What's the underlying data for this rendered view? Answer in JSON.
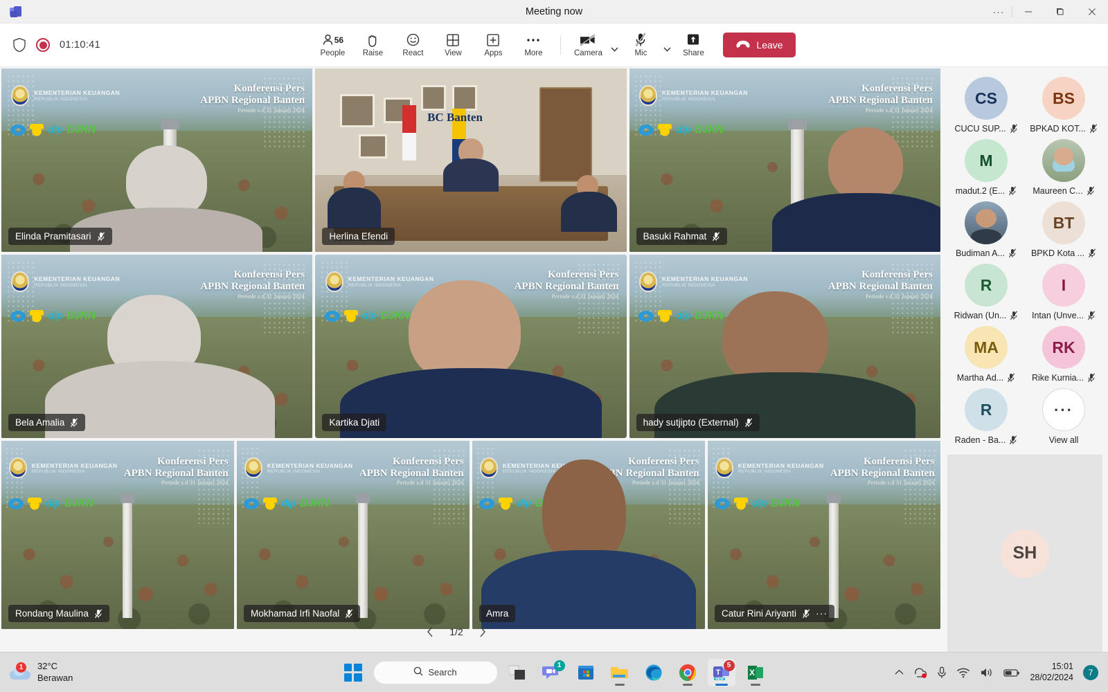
{
  "window": {
    "title": "Meeting now",
    "app_icon": "teams-icon",
    "controls": {
      "more": "···",
      "minimize": "–",
      "maximize": "❐",
      "close": "✕"
    }
  },
  "toolbar": {
    "shield_icon": "shield-icon",
    "recording_icon": "record-icon",
    "timer": "01:10:41",
    "items": [
      {
        "label": "People",
        "icon": "people-icon",
        "count": "56"
      },
      {
        "label": "Raise",
        "icon": "raise-hand-icon"
      },
      {
        "label": "React",
        "icon": "react-smiley-icon"
      },
      {
        "label": "View",
        "icon": "view-grid-icon"
      },
      {
        "label": "Apps",
        "icon": "apps-plus-icon"
      },
      {
        "label": "More",
        "icon": "more-ellipsis-icon"
      }
    ],
    "media": [
      {
        "label": "Camera",
        "icon": "camera-off-icon",
        "state": "off"
      },
      {
        "label": "Mic",
        "icon": "mic-off-icon",
        "state": "off"
      },
      {
        "label": "Share",
        "icon": "share-up-icon",
        "state": "idle"
      }
    ],
    "leave_label": "Leave",
    "leave_icon": "hangup-icon",
    "leave_color": "#c4314b"
  },
  "banner": {
    "ministry_line1": "KEMENTERIAN KEUANGAN",
    "ministry_line2": "REPUBLIK INDONESIA",
    "title_line1": "Konferensi Pers",
    "title_line2": "APBN Regional Banten",
    "title_line3": "Periode s.d  31 Januari 2024",
    "logo_djpb": "dip",
    "logo_djkn": "DJKN"
  },
  "stage": {
    "rows": [
      [
        {
          "name": "Elinda Pramitasari",
          "muted": true,
          "bg": "banner",
          "active": false,
          "more": false,
          "person": "woman-hijab-dark"
        },
        {
          "name": "Herlina Efendi",
          "muted": false,
          "bg": "room",
          "active": false,
          "more": false,
          "room_logo": "BC Banten"
        },
        {
          "name": "Basuki Rahmat",
          "muted": true,
          "bg": "banner",
          "active": false,
          "more": false,
          "person": "man-side"
        }
      ],
      [
        {
          "name": "Bela Amalia",
          "muted": true,
          "bg": "banner",
          "active": false,
          "more": false,
          "person": "woman-hijab-light"
        },
        {
          "name": "Kartika Djati",
          "muted": false,
          "bg": "banner",
          "active": true,
          "more": false,
          "person": "man-glasses-earphones"
        },
        {
          "name": "hady sutjipto (External)",
          "muted": true,
          "bg": "banner",
          "active": false,
          "more": false,
          "person": "man-dark-jacket"
        }
      ],
      [
        {
          "name": "Rondang Maulina",
          "muted": true,
          "bg": "banner",
          "active": false,
          "more": false,
          "person": "none"
        },
        {
          "name": "Mokhamad Irfi Naofal",
          "muted": true,
          "bg": "banner",
          "active": false,
          "more": false,
          "person": "none"
        },
        {
          "name": "Amra",
          "muted": false,
          "bg": "banner",
          "active": false,
          "more": false,
          "person": "man-glasses-blue"
        },
        {
          "name": "Catur Rini Ariyanti",
          "muted": true,
          "bg": "banner",
          "active": false,
          "more": true,
          "person": "none"
        }
      ]
    ],
    "pager": {
      "prev_icon": "chevron-left-icon",
      "label": "1/2",
      "next_icon": "chevron-right-icon"
    }
  },
  "roster": {
    "participants": [
      {
        "name": "CUCU SUP...",
        "initials": "CS",
        "bg": "#b8c9de",
        "fg": "#16325c",
        "muted": true,
        "photo": false
      },
      {
        "name": "BPKAD KOT...",
        "initials": "BS",
        "bg": "#f6d3c2",
        "fg": "#7a3412",
        "muted": true,
        "photo": false
      },
      {
        "name": "madut.2 (E...",
        "initials": "M",
        "bg": "#c6e7cf",
        "fg": "#14512b",
        "muted": true,
        "photo": false
      },
      {
        "name": "Maureen C...",
        "initials": "",
        "bg": "#9db58e",
        "fg": "#ffffff",
        "muted": true,
        "photo": "photo-2"
      },
      {
        "name": "Budiman A...",
        "initials": "",
        "bg": "#8fa6b8",
        "fg": "#ffffff",
        "muted": true,
        "photo": "photo-1"
      },
      {
        "name": "BPKD Kota ...",
        "initials": "BT",
        "bg": "#ece0d6",
        "fg": "#6a4327",
        "muted": true,
        "photo": false
      },
      {
        "name": "Ridwan (Un...",
        "initials": "R",
        "bg": "#c8e4d2",
        "fg": "#1b5c33",
        "muted": true,
        "photo": false
      },
      {
        "name": "Intan (Unve...",
        "initials": "I",
        "bg": "#f6cede",
        "fg": "#8a1245",
        "muted": true,
        "photo": false
      },
      {
        "name": "Martha Ad...",
        "initials": "MA",
        "bg": "#f7e6b4",
        "fg": "#7a5c0c",
        "muted": true,
        "photo": false
      },
      {
        "name": "Rike Kurnia...",
        "initials": "RK",
        "bg": "#f4c5d8",
        "fg": "#8d1a48",
        "muted": true,
        "photo": false
      },
      {
        "name": "Raden - Ba...",
        "initials": "R",
        "bg": "#cfe0e8",
        "fg": "#1d4d5e",
        "muted": true,
        "photo": false
      }
    ],
    "view_all": {
      "label": "View all",
      "icon": "more-ellipsis-icon"
    },
    "self_avatar": {
      "initials": "SH",
      "bg": "#f6e2d8",
      "fg": "#4d4441"
    }
  },
  "taskbar": {
    "weather": {
      "temp": "32°C",
      "desc": "Berawan",
      "badge": "1",
      "icon": "cloud-icon"
    },
    "start_icon": "windows-start-icon",
    "search": {
      "label": "Search",
      "icon": "search-icon"
    },
    "apps": [
      {
        "name": "task-view",
        "badge": "",
        "running": false
      },
      {
        "name": "chat-teams",
        "badge": "1",
        "running": false
      },
      {
        "name": "microsoft-store",
        "badge": "",
        "running": false
      },
      {
        "name": "file-explorer",
        "badge": "",
        "running": true
      },
      {
        "name": "microsoft-edge",
        "badge": "",
        "running": false
      },
      {
        "name": "google-chrome",
        "badge": "",
        "running": true
      },
      {
        "name": "microsoft-teams",
        "badge": "5",
        "running": true
      },
      {
        "name": "microsoft-excel",
        "badge": "",
        "running": true
      }
    ],
    "tray": {
      "chevron_icon": "chevron-up-icon",
      "onedrive_icon": "onedrive-sync-icon",
      "mic_icon": "mic-icon",
      "wifi_icon": "wifi-icon",
      "volume_icon": "volume-icon",
      "battery_icon": "battery-icon",
      "time": "15:01",
      "date": "28/02/2024",
      "notification_count": "7"
    }
  }
}
